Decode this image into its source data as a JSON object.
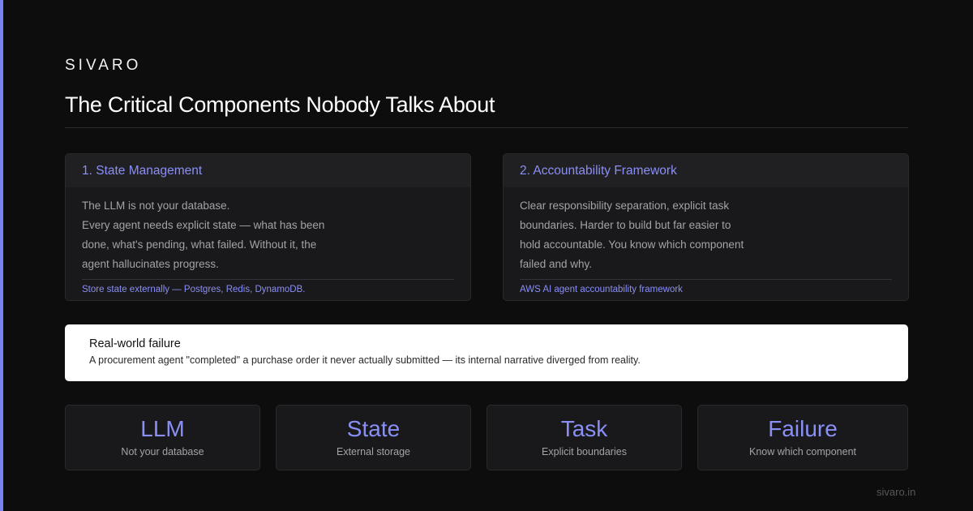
{
  "brand": "SIVARO",
  "title": "The Critical Components Nobody Talks About",
  "cards": [
    {
      "heading": "1. State Management",
      "lines": [
        "The LLM is not your database.",
        "Every agent needs explicit state — what has been",
        "done, what's pending, what failed. Without it, the",
        "agent hallucinates progress."
      ],
      "footer": "Store state externally — Postgres, Redis, DynamoDB."
    },
    {
      "heading": "2. Accountability Framework",
      "lines": [
        "Clear responsibility separation, explicit task",
        "boundaries. Harder to build but far easier to",
        "hold accountable. You know which component",
        "failed and why."
      ],
      "footer": "AWS AI agent accountability framework"
    }
  ],
  "callout": {
    "title": "Real-world failure",
    "text": "A procurement agent \"completed\" a purchase order it never actually submitted — its internal narrative diverged from reality."
  },
  "stats": [
    {
      "value": "LLM",
      "label": "Not your database"
    },
    {
      "value": "State",
      "label": "External storage"
    },
    {
      "value": "Task",
      "label": "Explicit boundaries"
    },
    {
      "value": "Failure",
      "label": "Know which component"
    }
  ],
  "footer_url": "sivaro.in",
  "colors": {
    "accent": "#7b83f0",
    "background": "#0d0d0e",
    "card": "#19191b",
    "callout": "#ffffff"
  }
}
